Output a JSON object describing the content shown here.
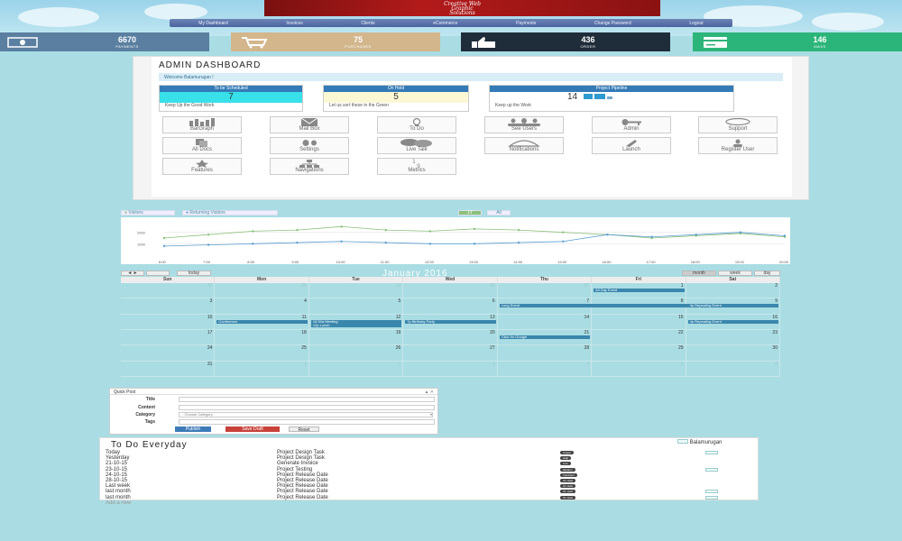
{
  "header": {
    "logo_lines": [
      "Creative Web",
      "Graphic",
      "Solutions"
    ],
    "nav": [
      "My Dashboard",
      "Invoices",
      "Clients",
      "eCommerce",
      "Payments",
      "Change Password",
      "Logout"
    ]
  },
  "stats": [
    {
      "value": "6670",
      "label": "PAYMENTS",
      "color": "#5a7fa0",
      "icon": "money-icon"
    },
    {
      "value": "75",
      "label": "PURCHASES",
      "color": "#d3b68c",
      "icon": "cart-icon"
    },
    {
      "value": "436",
      "label": "ORDER",
      "color": "#1f2d3a",
      "icon": "thumbs-up-icon"
    },
    {
      "value": "146",
      "label": "MASS",
      "color": "#2cb57a",
      "icon": "card-icon"
    }
  ],
  "admin": {
    "title": "ADMIN DASHBOARD",
    "welcome": "Welcome Balamurugan !",
    "panels": [
      {
        "heading": "To be Scheduled",
        "value": "7",
        "footer": "Keep Up the Good Work"
      },
      {
        "heading": "On Hold",
        "value": "5",
        "footer": "Let us sort these in the Green"
      },
      {
        "heading": "Project Pipeline",
        "value": "14",
        "footer": "Keep up the Work"
      }
    ],
    "tiles": [
      {
        "label": "BarGraph",
        "icon": "bar-chart-icon"
      },
      {
        "label": "Mail Box",
        "icon": "mail-icon"
      },
      {
        "label": "To Do",
        "icon": "lightbulb-icon"
      },
      {
        "label": "See Users",
        "icon": "users-icon"
      },
      {
        "label": "Admin",
        "icon": "key-icon"
      },
      {
        "label": "Support",
        "icon": "chat-icon"
      },
      {
        "label": "All Docs",
        "icon": "copy-icon"
      },
      {
        "label": "Settings",
        "icon": "gears-icon"
      },
      {
        "label": "Live Talk",
        "icon": "comments-icon"
      },
      {
        "label": "Notifications",
        "icon": "bell-icon"
      },
      {
        "label": "Launch",
        "icon": "rocket-icon"
      },
      {
        "label": "Register User",
        "icon": "user-add-icon"
      },
      {
        "label": "Features",
        "icon": "star-icon"
      },
      {
        "label": "Navigations",
        "icon": "sitemap-icon"
      },
      {
        "label": "Metrics",
        "icon": "numbers-icon"
      }
    ]
  },
  "chart_data": {
    "type": "line",
    "legend": [
      "Visitors",
      "Returning Visitors"
    ],
    "toggles": [
      "1Y",
      "All"
    ],
    "x": [
      "6:00",
      "7:00",
      "8:00",
      "9:00",
      "10:00",
      "11:00",
      "12:00",
      "13:00",
      "14:00",
      "15:00",
      "16:00",
      "17:00",
      "18:00",
      "19:00",
      "20:00"
    ],
    "yticks": [
      "2000",
      "1000"
    ],
    "ylim": [
      0,
      3000
    ],
    "series": [
      {
        "name": "Visitors",
        "color": "#8cc07a",
        "values": [
          1500,
          1800,
          2100,
          2200,
          2500,
          2200,
          2100,
          2300,
          2200,
          2000,
          1800,
          1500,
          1700,
          1900,
          1600
        ]
      },
      {
        "name": "Returning Visitors",
        "color": "#5a9fd0",
        "values": [
          800,
          900,
          1000,
          1100,
          1200,
          1100,
          1000,
          1000,
          1100,
          1200,
          1800,
          1600,
          1800,
          2000,
          1700
        ]
      }
    ]
  },
  "calendar": {
    "title": "January 2016",
    "today_label": "today",
    "views": [
      "month",
      "week",
      "day"
    ],
    "days": [
      "Sun",
      "Mon",
      "Tue",
      "Wed",
      "Thu",
      "Fri",
      "Sat"
    ],
    "weeks": [
      [
        "27",
        "28",
        "29",
        "30",
        "31",
        "1",
        "2"
      ],
      [
        "3",
        "4",
        "5",
        "6",
        "7",
        "8",
        "9"
      ],
      [
        "10",
        "11",
        "12",
        "13",
        "14",
        "15",
        "16"
      ],
      [
        "17",
        "18",
        "19",
        "20",
        "21",
        "22",
        "23"
      ],
      [
        "24",
        "25",
        "26",
        "27",
        "28",
        "29",
        "30"
      ],
      [
        "31",
        "1",
        "2",
        "3",
        "4",
        "5",
        "6"
      ]
    ],
    "events": [
      {
        "label": "All Day Event",
        "week": 0,
        "start": 5,
        "span": 1
      },
      {
        "label": "Long Event",
        "week": 1,
        "start": 4,
        "span": 3
      },
      {
        "label": "4p Repeating Event",
        "week": 1,
        "start": 6,
        "span": 1
      },
      {
        "label": "Conference",
        "week": 2,
        "start": 1,
        "span": 1
      },
      {
        "label": "10:30a Meeting",
        "week": 2,
        "start": 2,
        "span": 1
      },
      {
        "label": "12p Lunch",
        "week": 2,
        "start": 2,
        "span": 1
      },
      {
        "label": "7p Birthday Party",
        "week": 2,
        "start": 3,
        "span": 1
      },
      {
        "label": "4p Repeating Event",
        "week": 2,
        "start": 6,
        "span": 1
      },
      {
        "label": "Click for Google",
        "week": 3,
        "start": 4,
        "span": 1
      }
    ]
  },
  "quick_post": {
    "title": "Quick Post",
    "fields": [
      "Title",
      "Content",
      "Category",
      "Tags"
    ],
    "category_placeholder": "- Choose Category -",
    "buttons": [
      "Publish",
      "Save Draft",
      "Reset"
    ]
  },
  "todo": {
    "title": "To Do Everyday",
    "user": "Balamurugan",
    "rows": [
      {
        "date": "Today",
        "task": "Project Design Task",
        "badge": "Urgent",
        "badge_color": "#444",
        "check": true
      },
      {
        "date": "Yesterday",
        "task": "Project Design Task",
        "badge": "High",
        "badge_color": "#444",
        "check": false
      },
      {
        "date": "21-10-15",
        "task": "Generate Invoice",
        "badge": "Low",
        "badge_color": "#444",
        "check": false
      },
      {
        "date": "23-10-15",
        "task": "Project Testing",
        "badge": "Medium",
        "badge_color": "#444",
        "check": true
      },
      {
        "date": "24-10-15",
        "task": "Project Release Date",
        "badge": "Important",
        "badge_color": "#444",
        "check": false
      },
      {
        "date": "28-10-15",
        "task": "Project Release Date",
        "badge": "On Hold",
        "badge_color": "#444",
        "check": false
      },
      {
        "date": "Last week",
        "task": "Project Release Date",
        "badge": "On Hold",
        "badge_color": "#444",
        "check": false
      },
      {
        "date": "last month",
        "task": "Project Release Date",
        "badge": "On Hold",
        "badge_color": "#444",
        "check": true
      },
      {
        "date": "last month",
        "task": "Project Release Date",
        "badge": "On Hold",
        "badge_color": "#444",
        "check": true
      }
    ],
    "add_new": "Add a new"
  }
}
